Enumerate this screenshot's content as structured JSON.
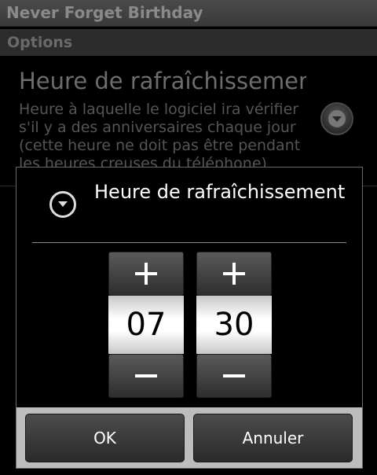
{
  "app": {
    "title": "Never Forget Birthday"
  },
  "background": {
    "section_header": "Options",
    "preference": {
      "title": "Heure de rafraîchissement",
      "summary": "Heure à laquelle le logiciel ira vérifier s'il y a des anniversaires chaque jour (cette heure ne doit pas être pendant les heures creuses du téléphone)",
      "icon": "chevron-down-circle-icon"
    }
  },
  "dialog": {
    "icon": "chevron-down-circle-icon",
    "title": "Heure de rafraîchissement",
    "time_picker": {
      "hours": "07",
      "minutes": "30",
      "increment_symbol": "+",
      "decrement_symbol": "−"
    },
    "buttons": {
      "ok": "OK",
      "cancel": "Annuler"
    }
  },
  "colors": {
    "dialog_background": "#000000",
    "button_bar": "#bdbdbd",
    "picker_value_background": "#ffffff"
  }
}
